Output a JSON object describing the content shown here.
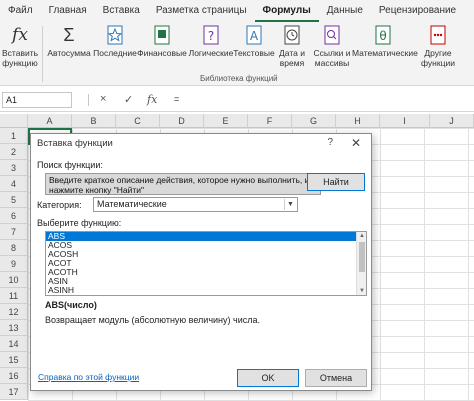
{
  "ribbon_tabs": [
    "Файл",
    "Главная",
    "Вставка",
    "Разметка страницы",
    "Формулы",
    "Данные",
    "Рецензирование"
  ],
  "active_tab": "Формулы",
  "ribbon": {
    "insert_function": {
      "icon": "fx-icon",
      "line1": "Вставить",
      "line2": "функцию"
    },
    "buttons": [
      {
        "name": "autosum",
        "icon": "sigma-icon",
        "line1": "Автосумма",
        "line2": ""
      },
      {
        "name": "recent",
        "icon": "star-icon",
        "line1": "Последние",
        "line2": ""
      },
      {
        "name": "financial",
        "icon": "book-icon",
        "line1": "Финансовые",
        "line2": ""
      },
      {
        "name": "logical",
        "icon": "question-book-icon",
        "line1": "Логические",
        "line2": ""
      },
      {
        "name": "text",
        "icon": "text-book-icon",
        "line1": "Текстовые",
        "line2": ""
      },
      {
        "name": "datetime",
        "icon": "clock-book-icon",
        "line1": "Дата и",
        "line2": "время"
      },
      {
        "name": "lookup",
        "icon": "search-book-icon",
        "line1": "Ссылки и",
        "line2": "массивы"
      },
      {
        "name": "math",
        "icon": "theta-book-icon",
        "line1": "Математические",
        "line2": ""
      },
      {
        "name": "more",
        "icon": "more-book-icon",
        "line1": "Другие",
        "line2": "функции"
      }
    ],
    "group_label": "Библиотека функций"
  },
  "formula_bar": {
    "name_box": "A1",
    "cancel_icon": "×",
    "enter_icon": "✓",
    "fx_label": "fx",
    "value": "="
  },
  "columns": [
    "A",
    "B",
    "C",
    "D",
    "E",
    "F",
    "G",
    "H",
    "I",
    "J"
  ],
  "rows": [
    "1",
    "2",
    "3",
    "4",
    "5",
    "6",
    "7",
    "8",
    "9",
    "10",
    "11",
    "12",
    "13",
    "14",
    "15",
    "16",
    "17"
  ],
  "cell_a1": "=",
  "dialog": {
    "title": "Вставка функции",
    "help": "?",
    "close": "✕",
    "search_label": "Поиск функции:",
    "search_value": "Введите краткое описание действия, которое нужно выполнить, и нажмите кнопку \"Найти\"",
    "find_button": "Найти",
    "category_label": "Категория:",
    "category_value": "Математические",
    "choose_label": "Выберите функцию:",
    "functions": [
      "ABS",
      "ACOS",
      "ACOSH",
      "ACOT",
      "ACOTH",
      "ASIN",
      "ASINH"
    ],
    "selected_function": "ABS",
    "signature": "ABS(число)",
    "description": "Возвращает модуль (абсолютную величину) числа.",
    "help_link": "Справка по этой функции",
    "ok": "OK",
    "cancel": "Отмена"
  },
  "colors": {
    "accent": "#217346",
    "selection": "#0078d7",
    "link": "#0563c1"
  }
}
